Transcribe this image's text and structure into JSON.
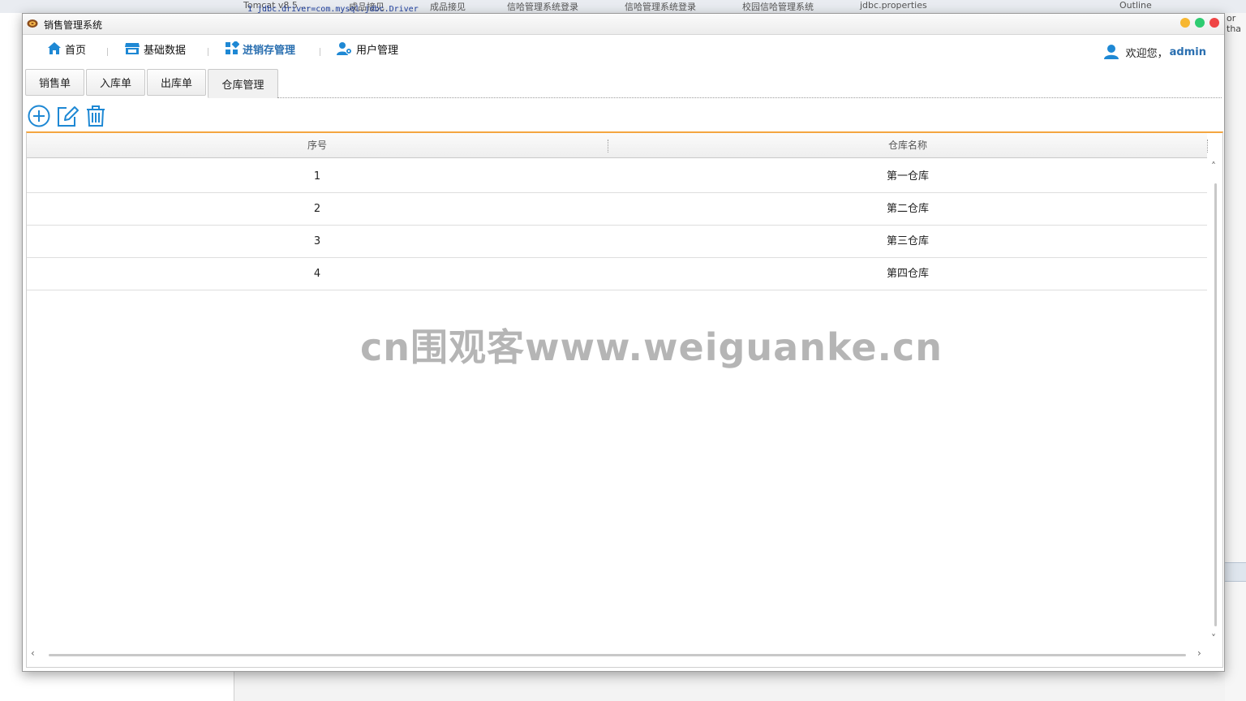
{
  "background": {
    "ide_tabs": [
      "Tomcat v8.5 ...",
      "成品接见",
      "成品接见",
      "信哈管理系统登录",
      "信哈管理系统登录",
      "校园信哈管理系统",
      "jdbc.properties"
    ],
    "code_line": "1 jdbc.driver=com.mysql.jdbc.Driver",
    "right_panel_title": "Outline",
    "right_panel_text": "or tha"
  },
  "window": {
    "title": "销售管理系统"
  },
  "menu": {
    "items": [
      {
        "label": "首页",
        "icon": "home-icon"
      },
      {
        "label": "基础数据",
        "icon": "store-icon"
      },
      {
        "label": "进销存管理",
        "icon": "grid-icon"
      },
      {
        "label": "用户管理",
        "icon": "users-gear-icon"
      }
    ],
    "active_index": 2
  },
  "user": {
    "welcome_text": "欢迎您，",
    "name": "admin"
  },
  "tabs": [
    {
      "label": "销售单"
    },
    {
      "label": "入库单"
    },
    {
      "label": "出库单"
    },
    {
      "label": "仓库管理"
    }
  ],
  "selected_tab_index": 3,
  "toolbar": {
    "add_icon": "plus-circle-icon",
    "edit_icon": "edit-icon",
    "delete_icon": "trash-icon"
  },
  "table": {
    "columns": [
      "序号",
      "仓库名称"
    ],
    "rows": [
      [
        "1",
        "第一仓库"
      ],
      [
        "2",
        "第二仓库"
      ],
      [
        "3",
        "第三仓库"
      ],
      [
        "4",
        "第四仓库"
      ]
    ]
  },
  "watermark": "cn围观客www.weiguanke.cn",
  "colors": {
    "accent": "#2a6fb0",
    "icon_blue": "#1e88d4",
    "table_top_border": "#f4a640",
    "win_close": "#ef4444",
    "win_min": "#f7b731",
    "win_max": "#2ecc71"
  }
}
